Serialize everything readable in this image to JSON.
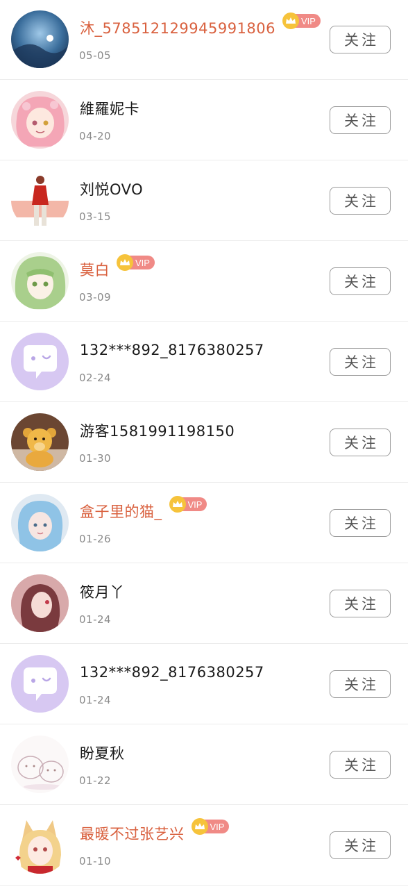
{
  "colors": {
    "vip_name": "#d9613f",
    "normal_name": "#1a1a1a",
    "date": "#8a8a8a",
    "vip_badge": "#f08a86",
    "vip_crown": "#f6c33b",
    "default_avatar_bg": "#d7c8f2",
    "follow_border": "#9a9a9a"
  },
  "users": [
    {
      "name": "沐_578512129945991806",
      "date": "05-05",
      "vip": true,
      "vip_label": "VIP",
      "follow_label": "关注",
      "avatar": "photo-blue-sky"
    },
    {
      "name": "維羅妮卡",
      "date": "04-20",
      "vip": false,
      "follow_label": "关注",
      "avatar": "anime-pink-hair"
    },
    {
      "name": "刘悦OVO",
      "date": "03-15",
      "vip": false,
      "follow_label": "关注",
      "avatar": "photo-red-dress"
    },
    {
      "name": "莫白",
      "date": "03-09",
      "vip": true,
      "vip_label": "VIP",
      "follow_label": "关注",
      "avatar": "anime-green-hair"
    },
    {
      "name": "132***892_8176380257",
      "date": "02-24",
      "vip": false,
      "follow_label": "关注",
      "avatar": "default-chat-bubble"
    },
    {
      "name": "游客1581991198150",
      "date": "01-30",
      "vip": false,
      "follow_label": "关注",
      "avatar": "photo-teddy-bear"
    },
    {
      "name": "盒子里的猫_",
      "date": "01-26",
      "vip": true,
      "vip_label": "VIP",
      "follow_label": "关注",
      "avatar": "photo-blue-hair-girl"
    },
    {
      "name": "筱月丫",
      "date": "01-24",
      "vip": false,
      "follow_label": "关注",
      "avatar": "art-pink-girl"
    },
    {
      "name": "132***892_8176380257",
      "date": "01-24",
      "vip": false,
      "follow_label": "关注",
      "avatar": "default-chat-bubble"
    },
    {
      "name": "盼夏秋",
      "date": "01-22",
      "vip": false,
      "follow_label": "关注",
      "avatar": "sketch-cute-animals"
    },
    {
      "name": "最暖不过张艺兴",
      "date": "01-10",
      "vip": true,
      "vip_label": "VIP",
      "follow_label": "关注",
      "avatar": "anime-fox-ears"
    }
  ]
}
